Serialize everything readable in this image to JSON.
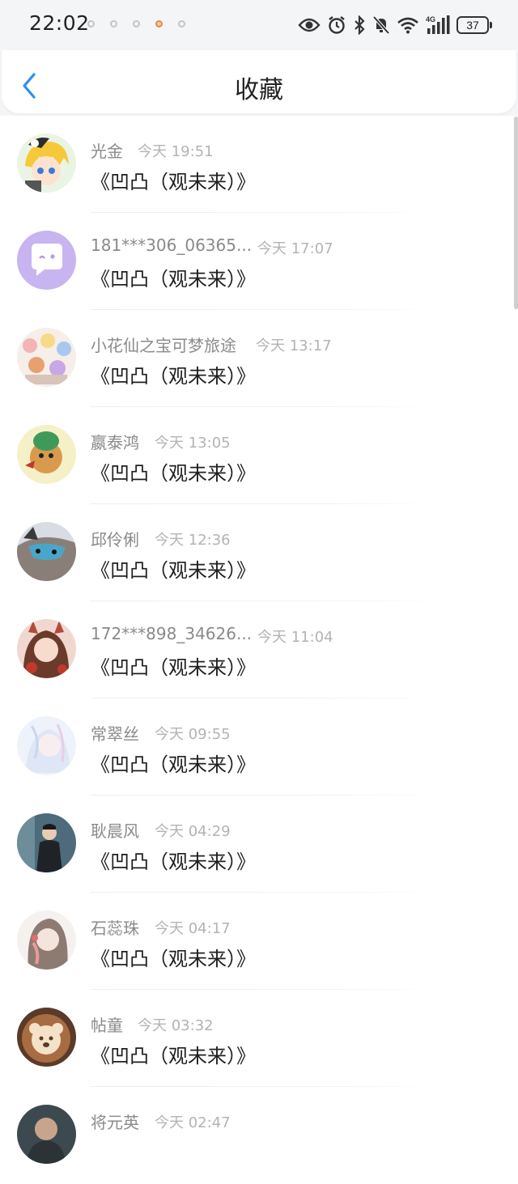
{
  "status_bar": {
    "time": "22:02",
    "battery": "37",
    "icons": [
      "eye-icon",
      "alarm-icon",
      "bluetooth-icon",
      "mute-icon",
      "wifi-icon",
      "signal-4g-icon",
      "battery-icon"
    ]
  },
  "nav": {
    "title": "收藏",
    "back_icon": "chevron-left-icon"
  },
  "colors": {
    "accent": "#2a8ff0",
    "name_text": "#8a8a8a",
    "time_text": "#b3b3b3",
    "content_text": "#1f1f1f"
  },
  "favorites": [
    {
      "name": "光金",
      "time": "今天 19:51",
      "content": "《凹凸（观未来）》",
      "avatar": "anime-avatar-blonde"
    },
    {
      "name": "181***306_06365...",
      "time": "今天 17:07",
      "content": "《凹凸（观未来）》",
      "avatar": "default-chat-avatar"
    },
    {
      "name": "小花仙之宝可梦旅途",
      "time": "今天 13:17",
      "content": "《凹凸（观未来）》",
      "avatar": "anime-group-avatar"
    },
    {
      "name": "嬴泰鸿",
      "time": "今天 13:05",
      "content": "《凹凸（观未来）》",
      "avatar": "cartoon-creature-avatar"
    },
    {
      "name": "邱伶俐",
      "time": "今天 12:36",
      "content": "《凹凸（观未来）》",
      "avatar": "masked-cat-avatar"
    },
    {
      "name": "172***898_34626...",
      "time": "今天 11:04",
      "content": "《凹凸（观未来）》",
      "avatar": "anime-girl-fox-avatar"
    },
    {
      "name": "常翠丝",
      "time": "今天 09:55",
      "content": "《凹凸（观未来）》",
      "avatar": "pastel-anime-avatar"
    },
    {
      "name": "耿晨风",
      "time": "今天 04:29",
      "content": "《凹凸（观未来）》",
      "avatar": "man-in-suit-avatar"
    },
    {
      "name": "石蕊珠",
      "time": "今天 04:17",
      "content": "《凹凸（观未来）》",
      "avatar": "sketch-girl-avatar"
    },
    {
      "name": "帖童",
      "time": "今天 03:32",
      "content": "《凹凸（观未来）》",
      "avatar": "latte-art-bear-avatar"
    },
    {
      "name": "将元英",
      "time": "今天 02:47",
      "content": "",
      "avatar": "photo-avatar"
    }
  ]
}
